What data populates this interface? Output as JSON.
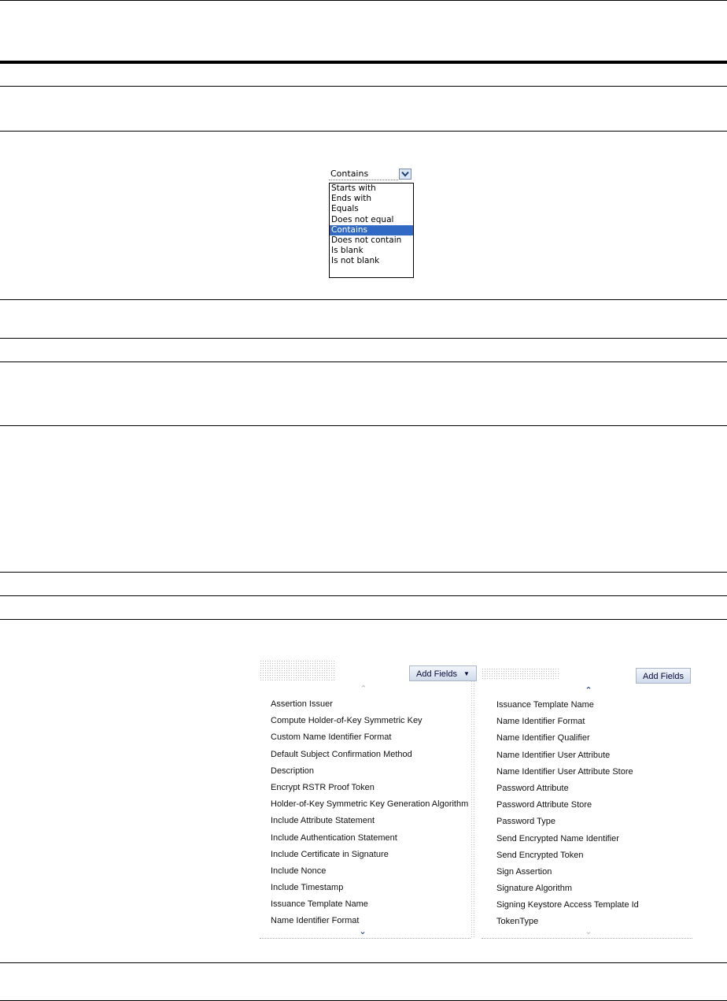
{
  "operator_dropdown": {
    "current_value": "Contains",
    "options": [
      "Starts with",
      "Ends with",
      "Equals",
      "Does not equal",
      "Contains",
      "Does not contain",
      "Is blank",
      "Is not blank"
    ],
    "selected_option": "Contains"
  },
  "add_fields_left": {
    "button_label": "Add Fields",
    "fields": [
      "Assertion Issuer",
      "Compute Holder-of-Key Symmetric Key",
      "Custom Name Identifier Format",
      "Default Subject Confirmation Method",
      "Description",
      "Encrypt RSTR Proof Token",
      "Holder-of-Key Symmetric Key Generation Algorithm",
      "Include Attribute Statement",
      "Include Authentication Statement",
      "Include Certificate in Signature",
      "Include Nonce",
      "Include Timestamp",
      "Issuance Template Name",
      "Name Identifier Format"
    ]
  },
  "add_fields_right": {
    "button_label": "Add Fields",
    "fields": [
      "Issuance Template Name",
      "Name Identifier Format",
      "Name Identifier Qualifier",
      "Name Identifier User Attribute",
      "Name Identifier User Attribute Store",
      "Password Attribute",
      "Password Attribute Store",
      "Password Type",
      "Send Encrypted Name Identifier",
      "Send Encrypted Token",
      "Sign Assertion",
      "Signature Algorithm",
      "Signing Keystore Access Template Id",
      "TokenType"
    ]
  },
  "icons": {
    "dropdown_arrow": "chevron-down-icon",
    "scroll_up": "chevron-up-icon",
    "scroll_down": "chevron-down-icon"
  }
}
